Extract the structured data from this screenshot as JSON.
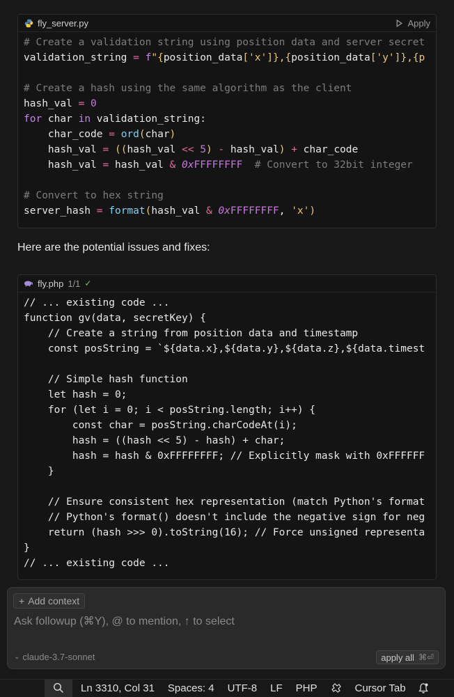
{
  "block1": {
    "filename": "fly_server.py",
    "apply_label": "Apply",
    "lines": [
      [
        [
          "c-com",
          "# Create a validation string using position data and server secret"
        ]
      ],
      [
        [
          "",
          "validation_string "
        ],
        [
          "c-op",
          "="
        ],
        [
          "",
          " "
        ],
        [
          "c-kw",
          "f"
        ],
        [
          "c-str",
          "\"{"
        ],
        [
          "",
          "position_data"
        ],
        [
          "c-str",
          "["
        ],
        [
          "c-str",
          "'x'"
        ],
        [
          "c-str",
          "]"
        ],
        [
          "c-str",
          "},{"
        ],
        [
          "",
          "position_data"
        ],
        [
          "c-str",
          "["
        ],
        [
          "c-str",
          "'y'"
        ],
        [
          "c-str",
          "]"
        ],
        [
          "c-str",
          "},{p"
        ]
      ],
      [
        [
          "",
          ""
        ]
      ],
      [
        [
          "c-com",
          "# Create a hash using the same algorithm as the client"
        ]
      ],
      [
        [
          "",
          "hash_val "
        ],
        [
          "c-op",
          "="
        ],
        [
          "",
          " "
        ],
        [
          "c-num",
          "0"
        ]
      ],
      [
        [
          "c-kw",
          "for"
        ],
        [
          "",
          " char "
        ],
        [
          "c-kw",
          "in"
        ],
        [
          "",
          " validation_string:"
        ]
      ],
      [
        [
          "",
          "    char_code "
        ],
        [
          "c-op",
          "="
        ],
        [
          "",
          " "
        ],
        [
          "c-fn",
          "ord"
        ],
        [
          "c-str",
          "("
        ],
        [
          "",
          "char"
        ],
        [
          "c-str",
          ")"
        ]
      ],
      [
        [
          "",
          "    hash_val "
        ],
        [
          "c-op",
          "="
        ],
        [
          "",
          " "
        ],
        [
          "c-str",
          "(("
        ],
        [
          "",
          "hash_val "
        ],
        [
          "c-op",
          "<<"
        ],
        [
          "",
          " "
        ],
        [
          "c-num",
          "5"
        ],
        [
          "c-str",
          ")"
        ],
        [
          "",
          " "
        ],
        [
          "c-op",
          "-"
        ],
        [
          "",
          " hash_val"
        ],
        [
          "c-str",
          ")"
        ],
        [
          "",
          " "
        ],
        [
          "c-op",
          "+"
        ],
        [
          "",
          " char_code"
        ]
      ],
      [
        [
          "",
          "    hash_val "
        ],
        [
          "c-op",
          "="
        ],
        [
          "",
          " hash_val "
        ],
        [
          "c-op",
          "&"
        ],
        [
          "",
          " "
        ],
        [
          "c-hex",
          "0x"
        ],
        [
          "c-num",
          "FFFFFFFF"
        ],
        [
          "",
          "  "
        ],
        [
          "c-com",
          "# Convert to 32bit integer"
        ]
      ],
      [
        [
          "",
          ""
        ]
      ],
      [
        [
          "c-com",
          "# Convert to hex string"
        ]
      ],
      [
        [
          "",
          "server_hash "
        ],
        [
          "c-op",
          "="
        ],
        [
          "",
          " "
        ],
        [
          "c-fn",
          "format"
        ],
        [
          "c-str",
          "("
        ],
        [
          "",
          "hash_val "
        ],
        [
          "c-op",
          "&"
        ],
        [
          "",
          " "
        ],
        [
          "c-hex",
          "0x"
        ],
        [
          "c-num",
          "FFFFFFFF"
        ],
        [
          "",
          ", "
        ],
        [
          "c-str",
          "'x'"
        ],
        [
          "c-str",
          ")"
        ]
      ]
    ]
  },
  "prose": "Here are the potential issues and fixes:",
  "block2": {
    "filename": "fly.php",
    "meta": "1/1",
    "lines": [
      "// ... existing code ...",
      "function gv(data, secretKey) {",
      "    // Create a string from position data and timestamp",
      "    const posString = `${data.x},${data.y},${data.z},${data.timest",
      "",
      "    // Simple hash function",
      "    let hash = 0;",
      "    for (let i = 0; i < posString.length; i++) {",
      "        const char = posString.charCodeAt(i);",
      "        hash = ((hash << 5) - hash) + char;",
      "        hash = hash & 0xFFFFFFFF; // Explicitly mask with 0xFFFFFF",
      "    }",
      "",
      "    // Ensure consistent hex representation (match Python's format",
      "    // Python's format() doesn't include the negative sign for neg",
      "    return (hash >>> 0).toString(16); // Force unsigned representa",
      "}",
      "// ... existing code ..."
    ]
  },
  "composer": {
    "add_context": "Add context",
    "placeholder": "Ask followup (⌘Y), @ to mention, ↑ to select",
    "model": "claude-3.7-sonnet",
    "apply_all": "apply all",
    "apply_all_shortcut": "⌘⏎"
  },
  "statusbar": {
    "position": "Ln 3310, Col 31",
    "spaces": "Spaces: 4",
    "encoding": "UTF-8",
    "eol": "LF",
    "language": "PHP",
    "cursor_tab": "Cursor Tab"
  },
  "colors": {
    "background": "#181818",
    "code_background": "#141414",
    "composer_background": "#2a2a2a"
  }
}
